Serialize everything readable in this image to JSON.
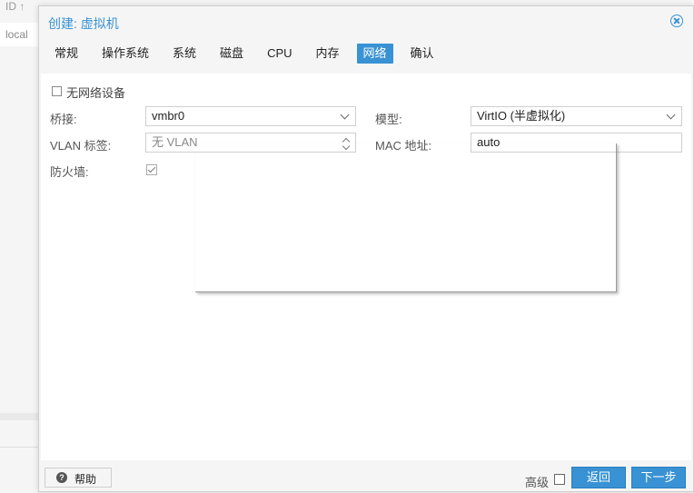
{
  "background": {
    "header_text": "ID ↑",
    "row_text": "local"
  },
  "dialog": {
    "title": "创建: 虚拟机",
    "tabs": [
      {
        "label": "常规"
      },
      {
        "label": "操作系统"
      },
      {
        "label": "系统"
      },
      {
        "label": "磁盘"
      },
      {
        "label": "CPU"
      },
      {
        "label": "内存"
      },
      {
        "label": "网络",
        "active": true
      },
      {
        "label": "确认"
      }
    ]
  },
  "form": {
    "no_network_label": "无网络设备",
    "no_network_checked": false,
    "bridge_label": "桥接:",
    "bridge_value": "vmbr0",
    "model_label": "模型:",
    "model_value": "VirtIO (半虚拟化)",
    "vlan_label": "VLAN 标签:",
    "vlan_value": "无 VLAN",
    "mac_label": "MAC 地址:",
    "mac_value": "auto",
    "firewall_label": "防火墙:",
    "firewall_checked": true
  },
  "footer": {
    "help_label": "帮助",
    "advanced_label": "高级",
    "advanced_checked": false,
    "back_label": "返回",
    "next_label": "下一步"
  },
  "colors": {
    "accent": "#3892d4"
  }
}
